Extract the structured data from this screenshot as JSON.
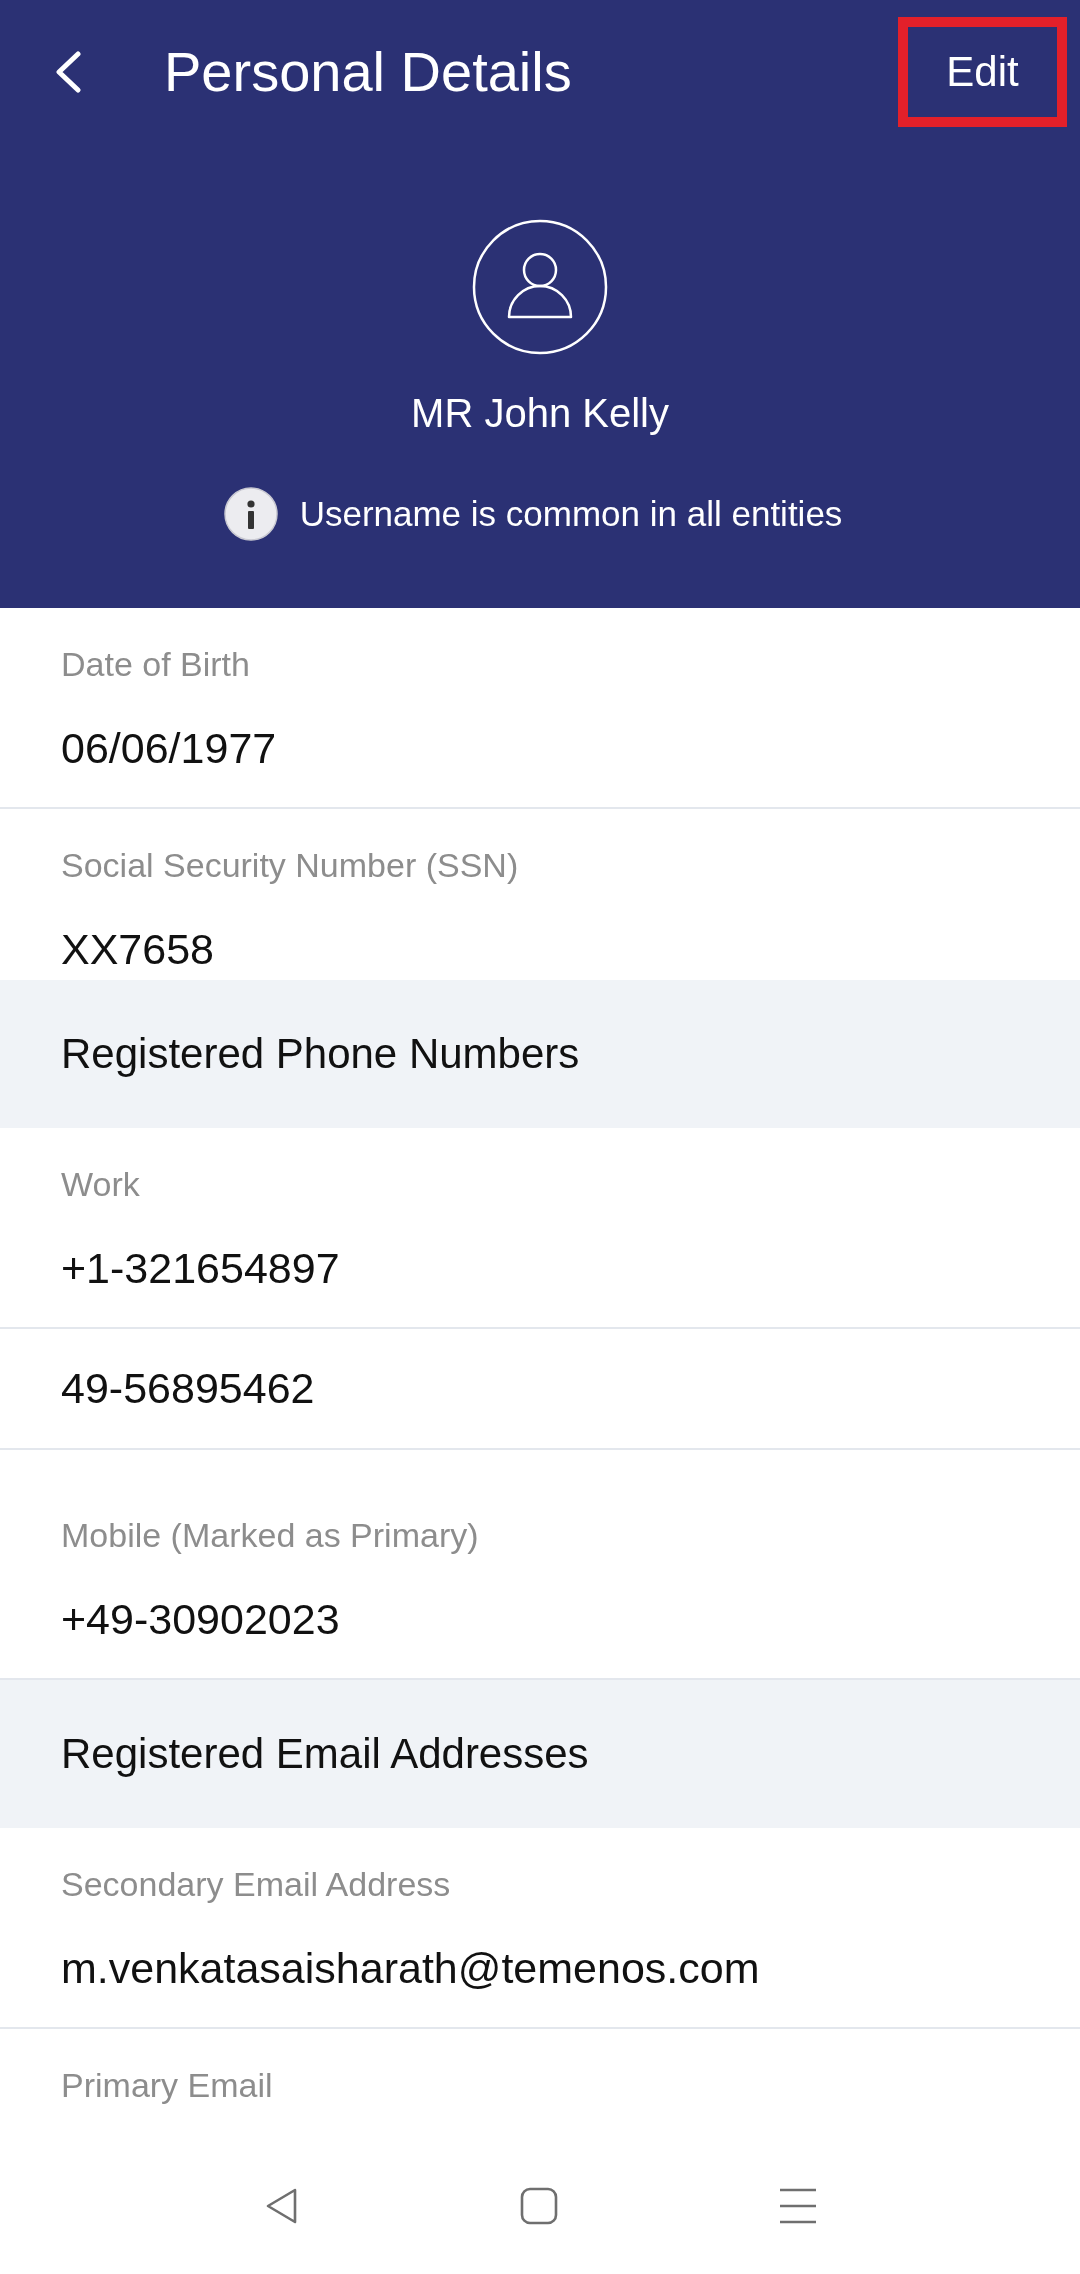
{
  "header": {
    "title": "Personal Details",
    "edit_button": {
      "label": "Edit",
      "highlighted": true
    }
  },
  "profile": {
    "name": "MR John Kelly",
    "notice": "Username is common in all entities"
  },
  "details": [
    {
      "kind": "field",
      "label": "Date of Birth",
      "value": "06/06/1977"
    },
    {
      "kind": "field",
      "label": "Social Security Number (SSN)",
      "value": "XX7658"
    },
    {
      "kind": "section",
      "title": "Registered Phone Numbers"
    },
    {
      "kind": "field",
      "label": "Work",
      "value": "+1-321654897"
    },
    {
      "kind": "field",
      "value": "49-56895462"
    },
    {
      "kind": "field",
      "label": "Mobile (Marked as Primary)",
      "value": "+49-30902023"
    },
    {
      "kind": "section",
      "title": "Registered Email Addresses"
    },
    {
      "kind": "field",
      "label": "Secondary Email Address",
      "value": "m.venkatasaisharath@temenos.com"
    },
    {
      "kind": "field",
      "label": "Primary Email"
    }
  ]
}
